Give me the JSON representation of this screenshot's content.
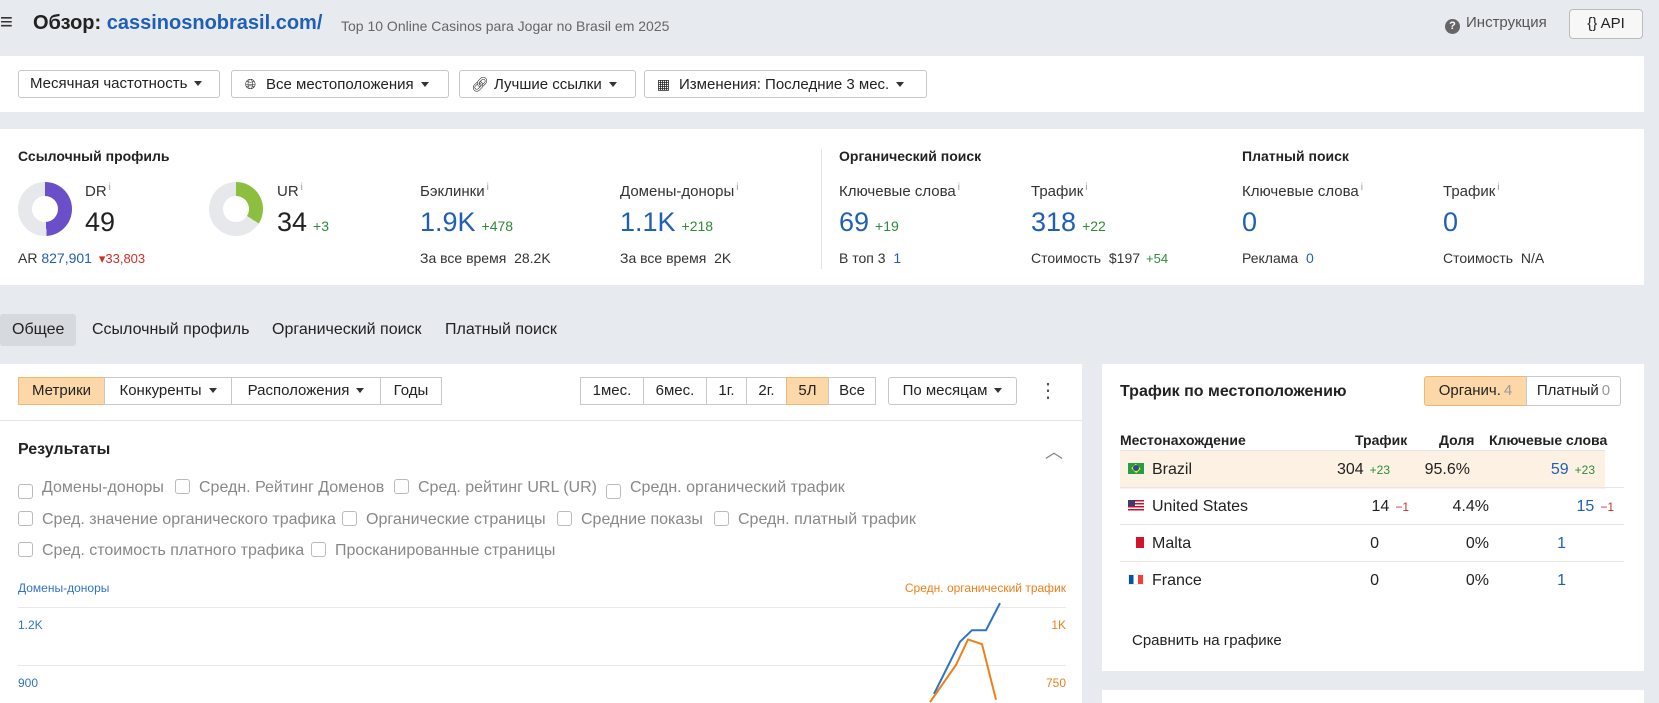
{
  "header": {
    "menu_icon": "hamburger-menu-icon",
    "title_prefix": "Обзор:",
    "domain": "cassinosnobrasil.com/",
    "subtitle": "Top 10 Online Casinos para Jogar no Brasil em 2025",
    "help_label": "Инструкция",
    "api_label": "{} API"
  },
  "filters": [
    {
      "label": "Месячная частотность",
      "icon": ""
    },
    {
      "label": "Все местоположения",
      "icon": "globe-icon"
    },
    {
      "label": "Лучшие ссылки",
      "icon": "link-icon"
    },
    {
      "label": "Изменения: Последние 3 мес.",
      "icon": "calendar-icon"
    }
  ],
  "metrics": {
    "link_profile": {
      "title": "Ссылочный профиль",
      "dr": {
        "label": "DR",
        "value": "49",
        "ring_fraction": 0.49,
        "color": "#6b4fc8"
      },
      "ar": {
        "label": "AR",
        "value": "827,901",
        "delta": "33,803"
      },
      "ur": {
        "label": "UR",
        "value": "34",
        "delta": "+3",
        "ring_fraction": 0.34,
        "color": "#8cbf3f"
      },
      "backlinks": {
        "label": "Бэклинки",
        "value": "1.9K",
        "delta": "+478",
        "sub_label": "За все время",
        "sub_value": "28.2K"
      },
      "ref_domains": {
        "label": "Домены-доноры",
        "value": "1.1K",
        "delta": "+218",
        "sub_label": "За все время",
        "sub_value": "2K"
      }
    },
    "organic": {
      "title": "Органический поиск",
      "keywords": {
        "label": "Ключевые слова",
        "value": "69",
        "delta": "+19",
        "sub_label": "В топ 3",
        "sub_value": "1"
      },
      "traffic": {
        "label": "Трафик",
        "value": "318",
        "delta": "+22",
        "sub_label": "Стоимость",
        "sub_value": "$197",
        "sub_delta": "+54"
      }
    },
    "paid": {
      "title": "Платный поиск",
      "keywords": {
        "label": "Ключевые слова",
        "value": "0",
        "sub_label": "Реклама",
        "sub_value": "0"
      },
      "traffic": {
        "label": "Трафик",
        "value": "0",
        "sub_label": "Стоимость",
        "sub_value": "N/A"
      }
    }
  },
  "tabs": [
    "Общее",
    "Ссылочный профиль",
    "Органический поиск",
    "Платный поиск"
  ],
  "chart_panel": {
    "mode_buttons": [
      "Метрики",
      "Конкуренты",
      "Расположения",
      "Годы"
    ],
    "period_buttons": [
      "1мес.",
      "6мес.",
      "1г.",
      "2г.",
      "5Л",
      "Все"
    ],
    "granularity": "По месяцам",
    "results_title": "Результаты",
    "checkboxes": [
      {
        "label": "Домены-доноры",
        "checked": true,
        "color": "#2f6fd6"
      },
      {
        "label": "Средн. Рейтинг Доменов",
        "checked": false
      },
      {
        "label": "Сред. рейтинг URL (UR)",
        "checked": false
      },
      {
        "label": "Средн. органический трафик",
        "checked": true,
        "color": "#ef7f1a"
      },
      {
        "label": "Сред. значение органического трафика",
        "checked": false
      },
      {
        "label": "Органические страницы",
        "checked": false
      },
      {
        "label": "Средние показы",
        "checked": false
      },
      {
        "label": "Средн. платный трафик",
        "checked": false
      },
      {
        "label": "Сред. стоимость платного трафика",
        "checked": false
      },
      {
        "label": "Просканированные страницы",
        "checked": false
      }
    ]
  },
  "chart_data": {
    "type": "line",
    "left_axis_title": "Домены-доноры",
    "right_axis_title": "Средн. органический трафик",
    "left_ticks": [
      "1.2K",
      "900"
    ],
    "right_ticks": [
      "1K",
      "750"
    ],
    "series": [
      {
        "name": "Домены-доноры",
        "color": "#2f73c9",
        "axis": "left",
        "values": [
          750,
          1020,
          1080,
          1080,
          1220
        ]
      },
      {
        "name": "Средн. органический трафик",
        "color": "#ef7f1a",
        "axis": "right",
        "values": [
          590,
          750,
          860,
          840,
          600
        ]
      }
    ]
  },
  "traffic_by_location": {
    "title": "Трафик по местоположению",
    "toggle": [
      {
        "label": "Органич.",
        "count": "4"
      },
      {
        "label": "Платный",
        "count": "0"
      }
    ],
    "columns": [
      "Местонахождение",
      "Трафик",
      "Доля",
      "Ключевые слова"
    ],
    "rows": [
      {
        "country": "Brazil",
        "flag": "brazil-flag-icon",
        "traffic": "304",
        "traffic_delta": "+23",
        "share": "95.6%",
        "keywords": "59",
        "keywords_delta": "+23"
      },
      {
        "country": "United States",
        "flag": "us-flag-icon",
        "traffic": "14",
        "traffic_delta": "−1",
        "share": "4.4%",
        "keywords": "15",
        "keywords_delta": "−1"
      },
      {
        "country": "Malta",
        "flag": "malta-flag-icon",
        "traffic": "0",
        "traffic_delta": "",
        "share": "0%",
        "keywords": "1",
        "keywords_delta": ""
      },
      {
        "country": "France",
        "flag": "france-flag-icon",
        "traffic": "0",
        "traffic_delta": "",
        "share": "0%",
        "keywords": "1",
        "keywords_delta": ""
      }
    ],
    "compare_label": "Сравнить на графике"
  }
}
